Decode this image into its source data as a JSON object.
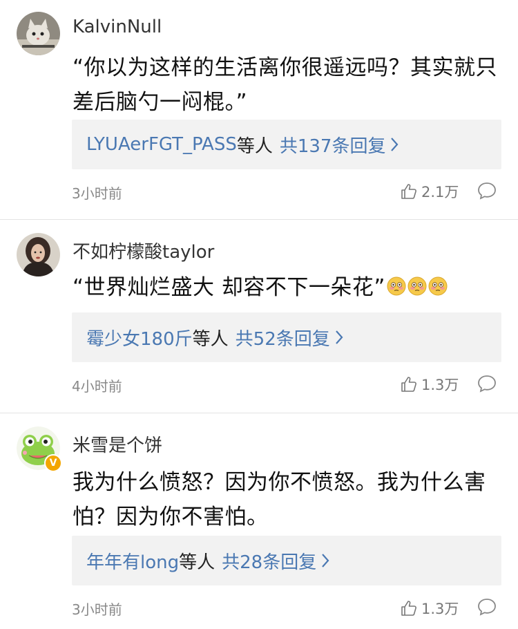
{
  "comments": [
    {
      "username": "KalvinNull",
      "text": "“你以为这样的生活离你很遥远吗？其实就只差后脑勺一闷棍。”",
      "reply_users": "LYUAerFGT_PASS",
      "reply_join": "等人",
      "reply_count": "共137条回复",
      "time": "3小时前",
      "likes": "2.1万",
      "avatar_icon": "cat-avatar"
    },
    {
      "username": "不如柠檬酸taylor",
      "text": "“世界灿烂盛大 却容不下一朵花”",
      "emojis": [
        "flushed-face-emoji",
        "flushed-face-emoji",
        "flushed-face-emoji"
      ],
      "reply_users": "霉少女180斤",
      "reply_join": "等人",
      "reply_count": "共52条回复",
      "time": "4小时前",
      "likes": "1.3万",
      "avatar_icon": "portrait-avatar"
    },
    {
      "username": "米雪是个饼",
      "text": "我为什么愤怒？因为你不愤怒。我为什么害怕？因为你不害怕。",
      "reply_users": "年年有long",
      "reply_join": "等人",
      "reply_count": "共28条回复",
      "time": "3小时前",
      "likes": "1.3万",
      "avatar_icon": "frog-avatar",
      "verified_badge": "V"
    }
  ],
  "colors": {
    "link_blue": "#4a78b2",
    "reply_bg": "#f2f2f2",
    "meta_gray": "#888888",
    "divider": "#e3e3e3"
  }
}
